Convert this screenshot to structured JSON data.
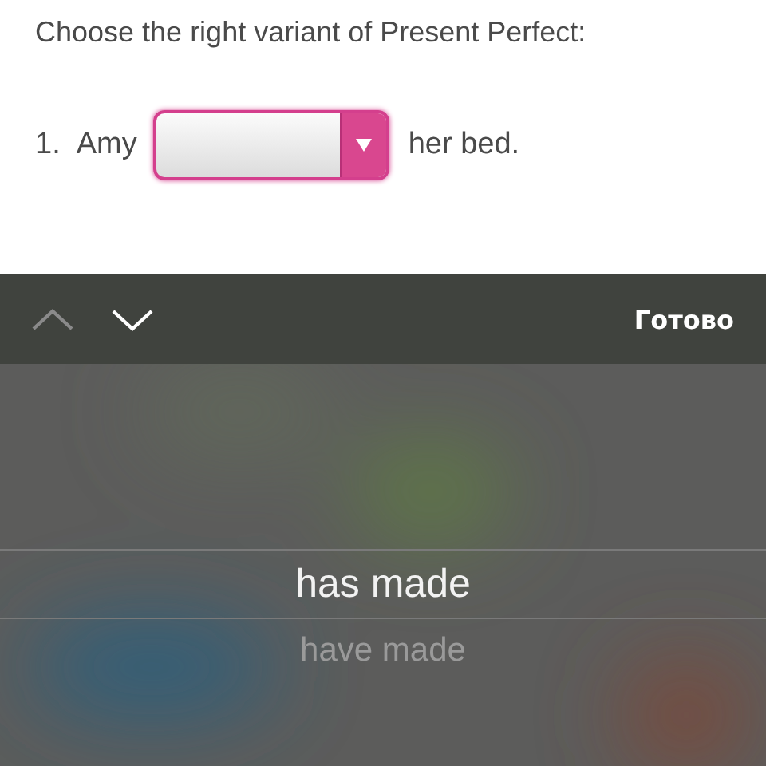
{
  "instruction": "Choose the right variant of Present Perfect:",
  "question": {
    "number": "1.",
    "before": "Amy",
    "after": "her bed.",
    "answer": {
      "expanded": true
    }
  },
  "toolbar": {
    "buttons": [
      {
        "kind": "up",
        "disabled": true
      },
      {
        "kind": "down",
        "disabled": false
      }
    ],
    "done": "Готово"
  },
  "picker": {
    "options": [
      {
        "label": "has made",
        "selected": true
      },
      {
        "label": "have made",
        "selected": false
      }
    ]
  }
}
